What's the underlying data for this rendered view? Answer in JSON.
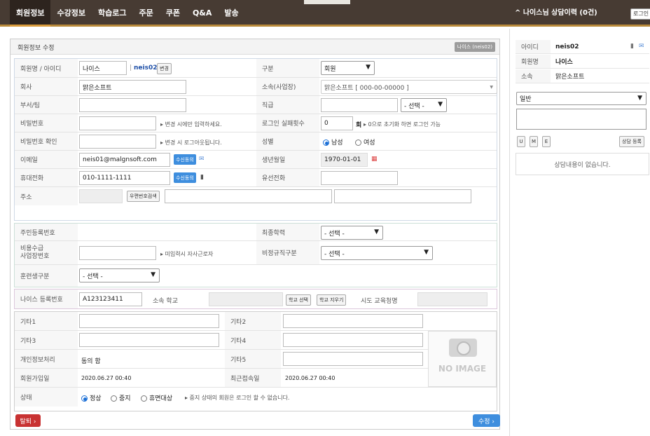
{
  "nav": {
    "items": [
      "회원정보",
      "수강정보",
      "학습로그",
      "주문",
      "쿠폰",
      "Q&A",
      "발송"
    ]
  },
  "right": {
    "title": "^ 나이스님 상담이력 (0건)",
    "login": "로그인",
    "rows": [
      {
        "label": "아이디",
        "value": "neis02"
      },
      {
        "label": "회원명",
        "value": "나이스"
      },
      {
        "label": "소속",
        "value": "맑은소프트"
      }
    ],
    "category": "일반",
    "btn_u": "U",
    "btn_m": "M",
    "btn_e": "E",
    "register": "상담 등록",
    "empty": "상담내용이 없습니다."
  },
  "panel": {
    "title": "회원정보 수정",
    "badge": "나이스 (neis02)"
  },
  "form": {
    "name_label": "회원명 / 아이디",
    "name": "나이스",
    "id_sep": "|",
    "id": "neis02",
    "change": "변경",
    "type_label": "구분",
    "type": "회원",
    "company_label": "회사",
    "company": "맑은소프트",
    "affil_label": "소속(사업장)",
    "affil": "맑은소프트 [ 000-00-00000 ]",
    "dept_label": "부서/팀",
    "position_label": "직급",
    "position_sel": "- 선택 -",
    "pw_label": "비밀번호",
    "pw_note": "▸ 변경 시에만 입력하세요.",
    "fail_label": "로그인 실패횟수",
    "fail": "0",
    "fail_unit": "회",
    "fail_note": "▸ 0으로 초기화 하면 로그인 가능",
    "pw2_label": "비밀번호 확인",
    "pw2_note": "▸ 변경 시 로그아웃됩니다.",
    "gender_label": "성별",
    "male": "남성",
    "female": "여성",
    "email_label": "이메일",
    "email": "neis01@malgnsoft.com",
    "agree": "수신동의",
    "birth_label": "생년월일",
    "birth": "1970-01-01",
    "mobile_label": "휴대전화",
    "mobile": "010-1111-1111",
    "phone_label": "유선전화",
    "addr_label": "주소",
    "zip_btn": "우편번호검색",
    "ssn_label": "주민등록번호",
    "edu_label": "최종학력",
    "edu_sel": "- 선택 -",
    "biz_label1": "비용수급",
    "biz_label2": "사업장번호",
    "biz_note": "▸ 미입력시 자사근로자",
    "irregular_label": "비정규직구분",
    "irregular_sel": "- 선택 -",
    "trainee_label": "훈련생구분",
    "trainee_sel": "- 선택 -",
    "neis_label": "나이스 등록번호",
    "neis": "A123123411",
    "school_label": "소속 학교",
    "school_select": "학교 선택",
    "school_clear": "학교 지우기",
    "office_label": "시도 교육청명",
    "etc1": "기타1",
    "etc2": "기타2",
    "etc3": "기타3",
    "etc4": "기타4",
    "etc5": "기타5",
    "privacy_label": "개인정보처리",
    "privacy": "동의 함",
    "join_label": "회원가입일",
    "join": "2020.06.27 00:40",
    "last_label": "최근접속일",
    "last": "2020.06.27 00:40",
    "status_label": "상태",
    "s1": "정상",
    "s2": "중지",
    "s3": "휴면대상",
    "status_note": "▸ 중지 상태의 회원은 로그인 할 수 없습니다.",
    "noimage": "NO IMAGE"
  },
  "footer": {
    "withdraw": "탈퇴 ›",
    "save": "수정 ›"
  }
}
